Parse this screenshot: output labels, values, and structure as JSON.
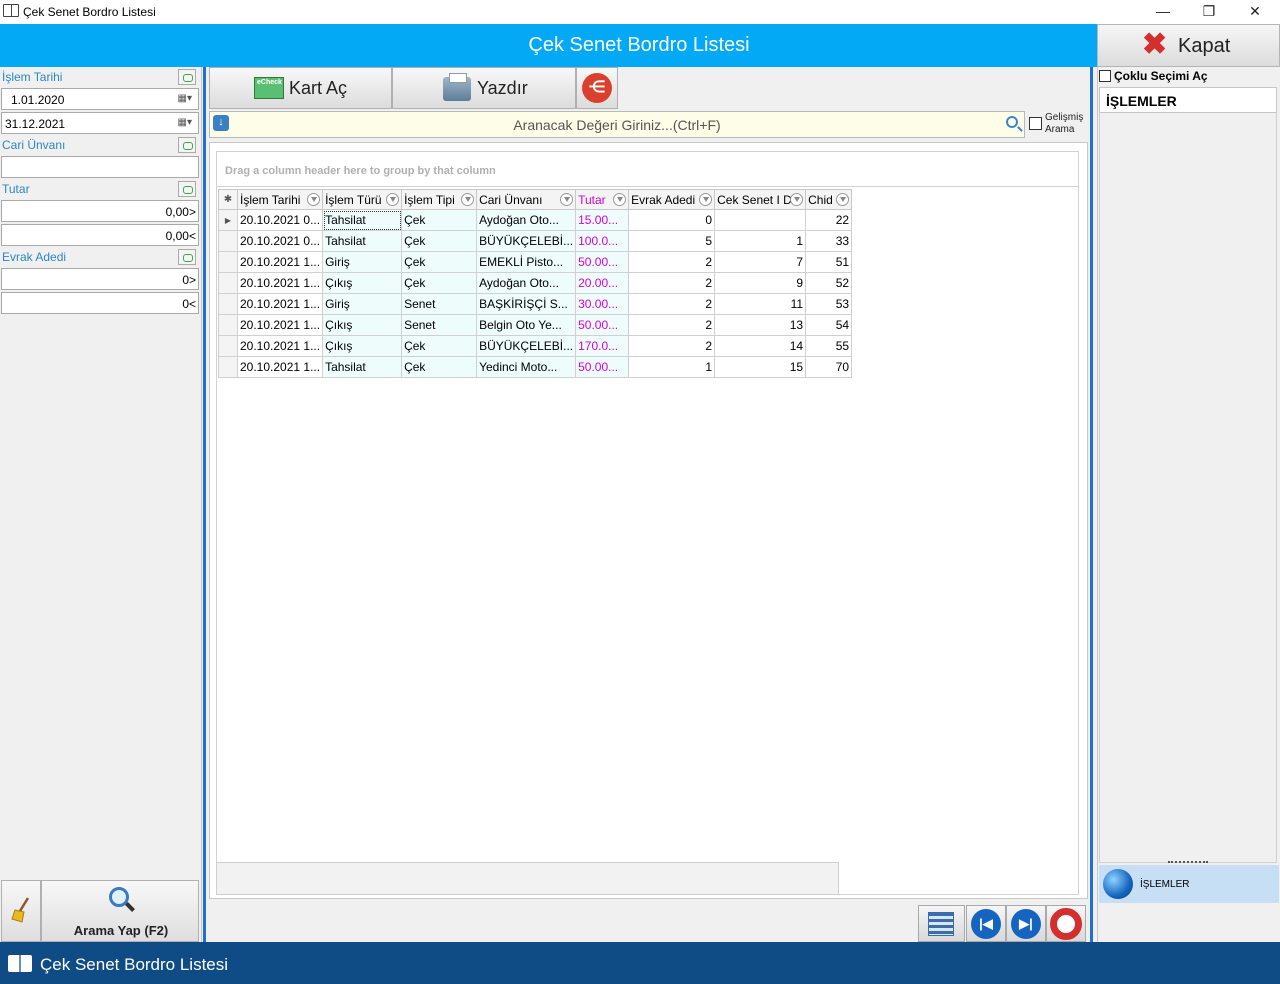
{
  "window": {
    "title": "Çek Senet Bordro Listesi",
    "minimize": "—",
    "restore": "❐",
    "close": "✕"
  },
  "header": {
    "title": "Çek Senet Bordro Listesi",
    "close_label": "Kapat"
  },
  "filters": {
    "islem_tarihi_label": "İşlem Tarihi",
    "date_from": "1.01.2020",
    "date_to": "31.12.2021",
    "cari_label": "Cari Ünvanı",
    "cari_value": "",
    "tutar_label": "Tutar",
    "tutar_min": "0,00>",
    "tutar_max": "0,00<",
    "evrak_label": "Evrak Adedi",
    "evrak_min": "0>",
    "evrak_max": "0<",
    "search_button": "Arama Yap (F2)"
  },
  "toolbar": {
    "kart_ac": "Kart Aç",
    "yazdir": "Yazdır",
    "share_icon": "share-icon"
  },
  "search": {
    "placeholder": "Aranacak Değeri Giriniz...(Ctrl+F)",
    "advanced": [
      "Gelişmiş",
      "Arama"
    ]
  },
  "grid": {
    "group_hint": "Drag a column header here to group by that column",
    "columns": [
      "İşlem Tarihi",
      "İşlem Türü",
      "İşlem Tipi",
      "Cari Ünvanı",
      "Tutar",
      "Evrak Adedi",
      "Cek Senet I D",
      "Chid"
    ],
    "rows": [
      [
        "20.10.2021 0...",
        "Tahsilat",
        "Çek",
        "Aydoğan Oto...",
        "15.00...",
        "0",
        "",
        "22"
      ],
      [
        "20.10.2021 0...",
        "Tahsilat",
        "Çek",
        "BÜYÜKÇELEBİ...",
        "100.0...",
        "5",
        "1",
        "33"
      ],
      [
        "20.10.2021 1...",
        "Giriş",
        "Çek",
        "EMEKLİ Pisto...",
        "50.00...",
        "2",
        "7",
        "51"
      ],
      [
        "20.10.2021 1...",
        "Çıkış",
        "Çek",
        "Aydoğan Oto...",
        "20.00...",
        "2",
        "9",
        "52"
      ],
      [
        "20.10.2021 1...",
        "Giriş",
        "Senet",
        "BAŞKİRİŞÇİ S...",
        "30.00...",
        "2",
        "11",
        "53"
      ],
      [
        "20.10.2021 1...",
        "Çıkış",
        "Senet",
        "Belgin Oto Ye...",
        "50.00...",
        "2",
        "13",
        "54"
      ],
      [
        "20.10.2021 1...",
        "Çıkış",
        "Çek",
        "BÜYÜKÇELEBİ...",
        "170.0...",
        "2",
        "14",
        "55"
      ],
      [
        "20.10.2021 1...",
        "Tahsilat",
        "Çek",
        "Yedinci Moto...",
        "50.00...",
        "1",
        "15",
        "70"
      ]
    ]
  },
  "right_panel": {
    "multi_select": "Çoklu Seçimi Aç",
    "header": "İŞLEMLER",
    "item": "İŞLEMLER"
  },
  "taskbar": {
    "title": "Çek Senet Bordro Listesi"
  },
  "colors": {
    "header_bg": "#03a9f4",
    "tutar_color": "#d600d6",
    "label_color": "#2e86c1",
    "taskbar_bg": "#0f4c85"
  }
}
